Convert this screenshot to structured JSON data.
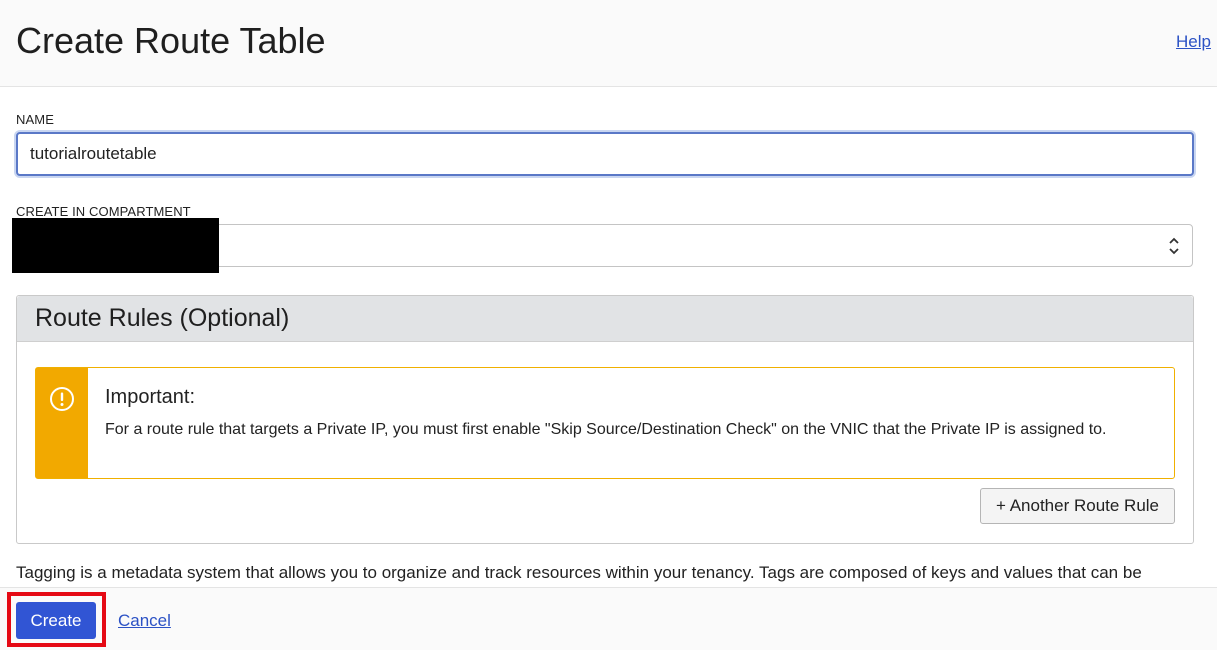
{
  "header": {
    "title": "Create Route Table",
    "help_label": "Help"
  },
  "form": {
    "name_label": "NAME",
    "name_value": "tutorialroutetable",
    "compartment_label": "CREATE IN COMPARTMENT",
    "compartment_value": ""
  },
  "route_rules": {
    "title": "Route Rules (Optional)",
    "notice": {
      "icon": "warning-icon",
      "title": "Important:",
      "text": "For a route rule that targets a Private IP, you must first enable \"Skip Source/Destination Check\" on the VNIC that the Private IP is assigned to."
    },
    "add_button_label": "+ Another Route Rule"
  },
  "tagging": {
    "text": "Tagging is a metadata system that allows you to organize and track resources within your tenancy. Tags are composed of keys and values that can be"
  },
  "footer": {
    "create_label": "Create",
    "cancel_label": "Cancel"
  },
  "colors": {
    "primary": "#3155d4",
    "link": "#2c52c5",
    "warning": "#f2a900",
    "highlight": "#e50914"
  }
}
